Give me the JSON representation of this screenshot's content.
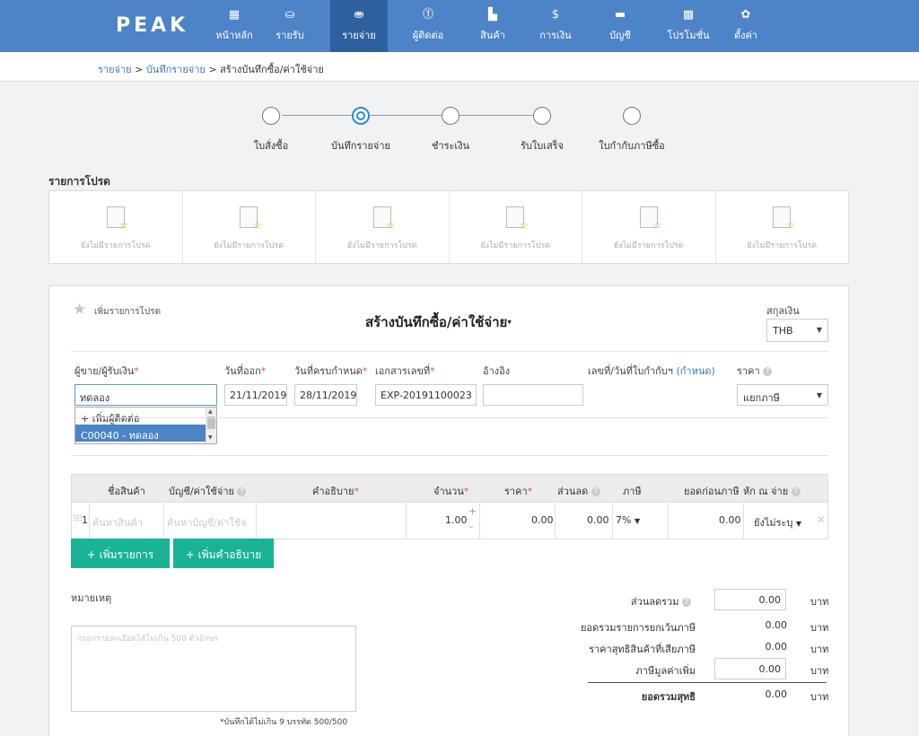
{
  "nav": {
    "logo": "PEAK",
    "items": [
      {
        "icon": "grid-icon",
        "glyph": "▦",
        "label": "หน้าหลัก"
      },
      {
        "icon": "income-icon",
        "glyph": "⛀",
        "label": "รายรับ"
      },
      {
        "icon": "expense-icon",
        "glyph": "⛂",
        "label": "รายจ่าย"
      },
      {
        "icon": "contact-icon",
        "glyph": "⓵",
        "label": "ผู้ติดต่อ"
      },
      {
        "icon": "product-icon",
        "glyph": "▙",
        "label": "สินค้า"
      },
      {
        "icon": "money-icon",
        "glyph": "$",
        "label": "การเงิน"
      },
      {
        "icon": "briefcase-icon",
        "glyph": "▬",
        "label": "บัญชี"
      },
      {
        "icon": "gift-icon",
        "glyph": "▩",
        "label": "โปรโมชั่น"
      },
      {
        "icon": "gear-icon",
        "glyph": "✿",
        "label": "ตั้งค่า"
      }
    ],
    "active_color": "#2e5f9e",
    "bar_color": "#4d83c7"
  },
  "breadcrumb": {
    "part1": "รายจ่าย",
    "sep": " > ",
    "part2": "บันทึกรายจ่าย",
    "part3": "สร้างบันทึกซื้อ/ค่าใช้จ่าย"
  },
  "steps": [
    {
      "label": "ใบสั่งซื้อ",
      "active": false
    },
    {
      "label": "บันทึกรายจ่าย",
      "active": true
    },
    {
      "label": "ชำระเงิน",
      "active": false
    },
    {
      "label": "รับใบเสร็จ",
      "active": false
    },
    {
      "label": "ใบกำกับภาษีซื้อ",
      "active": false
    }
  ],
  "favorites": {
    "title": "รายการโปรด",
    "items": [
      "ยังไม่มีรายการโปรด",
      "ยังไม่มีรายการโปรด",
      "ยังไม่มีรายการโปรด",
      "ยังไม่มีรายการโปรด",
      "ยังไม่มีรายการโปรด",
      "ยังไม่มีรายการโปรด"
    ]
  },
  "form": {
    "add_favorite": "เพิ่มรายการโปรด",
    "title": "สร้างบันทึกซื้อ/ค่าใช้จ่าย",
    "title_caret": "▾",
    "currency_label": "สกุลเงิน",
    "currency_value": "THB",
    "labels": {
      "vendor": "ผู้ขาย/ผู้รับเงิน",
      "issue_date": "วันที่ออก",
      "due_date": "วันที่ครบกำหนด",
      "doc_no": "เอกสารเลขที่",
      "reference": "อ้างอิง",
      "tax_invoice": "เลขที่/วันที่ใบกำกับฯ",
      "tax_invoice_link": "(กำหนด)",
      "price": "ราคา"
    },
    "req_mark": "*",
    "vendor_value": "ทดลอง",
    "issue_date_value": "21/11/2019",
    "due_date_value": "28/11/2019",
    "doc_no_value": "EXP-20191100023",
    "reference_value": "",
    "price_value": "แยกภาษี",
    "dropdown": {
      "items": [
        "+ เพิ่มผู้ติดต่อ",
        "C00040 - ทดลอง"
      ],
      "selected_index": 1
    }
  },
  "table": {
    "headers": {
      "product": "ชื่อสินค้า",
      "account": "บัญชี/ค่าใช้จ่าย",
      "description": "คำอธิบาย",
      "qty": "จำนวน",
      "price": "ราคา",
      "discount": "ส่วนลด",
      "tax": "ภาษี",
      "pretax": "ยอดก่อนภาษี",
      "wht": "หัก ณ จ่าย"
    },
    "row": {
      "index": "1",
      "product_placeholder": "ค้นหาสินค้า",
      "account_placeholder": "ค้นหาบัญชี/ค่าใช้จ่",
      "qty": "1.00",
      "price": "0.00",
      "discount": "0.00",
      "tax": "7%",
      "pretax": "0.00",
      "wht": "ยังไม่ระบุ"
    },
    "add_row_button": "+ เพิ่มรายการ",
    "add_desc_button": "+ เพิ่มคำอธิบาย"
  },
  "notes": {
    "label": "หมายเหตุ",
    "placeholder": "กรอกรายละเอียดได้ไม่เกิน 500 ตัวอักษร",
    "counter": "*บันทึกได้ไม่เกิน 9 บรรทัด 500/500"
  },
  "summary": {
    "unit": "บาท",
    "rows": [
      {
        "label": "ส่วนลดรวม",
        "value": "0.00"
      },
      {
        "label": "ยอดรวมรายการยกเว้นภาษี",
        "value": "0.00"
      },
      {
        "label": "ราคาสุทธิสินค้าที่เสียภาษี",
        "value": "0.00"
      },
      {
        "label": "ภาษีมูลค่าเพิ่ม",
        "value": "0.00"
      },
      {
        "label": "ยอดรวมสุทธิ",
        "value": "0.00"
      }
    ]
  }
}
